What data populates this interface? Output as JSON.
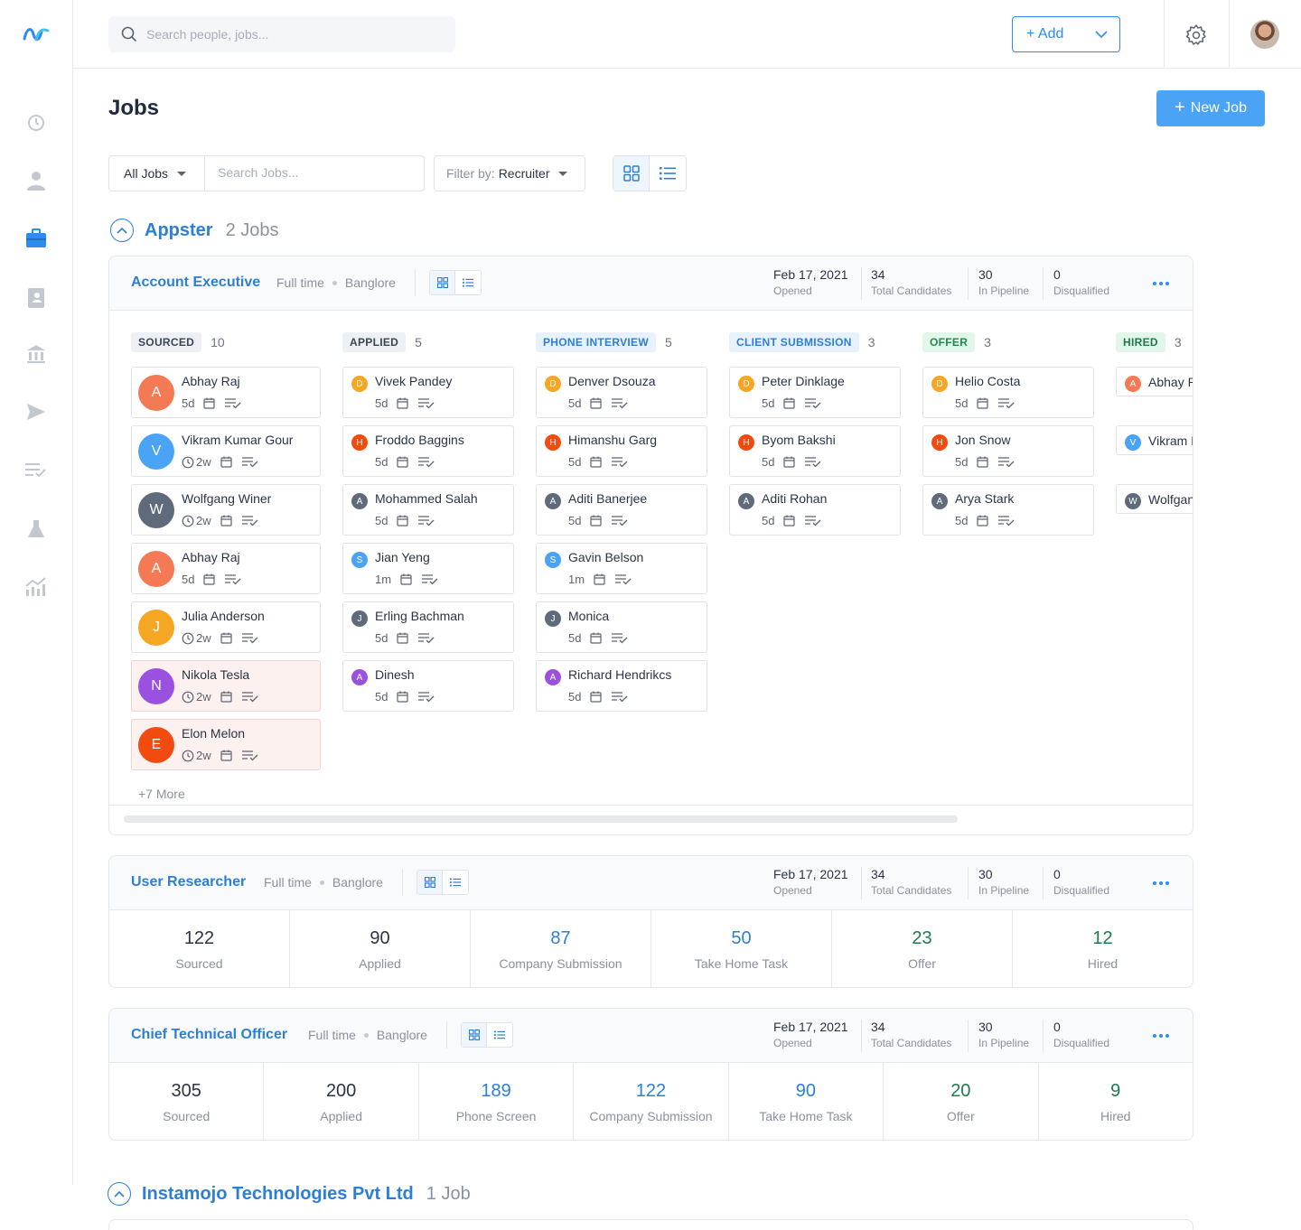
{
  "search": {
    "placeholder": "Search people, jobs..."
  },
  "header": {
    "add_label": "+ Add"
  },
  "page": {
    "title": "Jobs",
    "new_job_label": "New Job"
  },
  "filters": {
    "jobs_select": "All Jobs",
    "search_placeholder": "Search Jobs...",
    "filter_prefix": "Filter by:",
    "filter_value": "Recruiter"
  },
  "groups": [
    {
      "name": "Appster",
      "count": "2 Jobs"
    },
    {
      "name": "Instamojo Technologies Pvt Ltd",
      "count": "1 Job"
    }
  ],
  "stat_labels": {
    "opened": "Opened",
    "total": "Total Candidates",
    "pipeline": "In Pipeline",
    "disqualified": "Disqualified"
  },
  "jobs": [
    {
      "title": "Account Executive",
      "type": "Full time",
      "location": "Banglore",
      "opened": "Feb 17, 2021",
      "total": "34",
      "pipeline": "30",
      "disqualified": "0",
      "columns": [
        {
          "stage": "SOURCED",
          "count": "10",
          "more": "+7 More",
          "candidates": [
            {
              "name": "Abhay Raj",
              "initial": "A",
              "time": "5d",
              "clock": false,
              "color": "#f47a55",
              "flag": false
            },
            {
              "name": "Vikram Kumar Gour",
              "initial": "V",
              "time": "2w",
              "clock": true,
              "color": "#4aa3f5",
              "flag": false
            },
            {
              "name": "Wolfgang Winer",
              "initial": "W",
              "time": "2w",
              "clock": true,
              "color": "#5f6b7a",
              "flag": false
            },
            {
              "name": "Abhay Raj",
              "initial": "A",
              "time": "5d",
              "clock": false,
              "color": "#f47a55",
              "flag": false
            },
            {
              "name": "Julia Anderson",
              "initial": "J",
              "time": "2w",
              "clock": true,
              "color": "#f5a623",
              "flag": false
            },
            {
              "name": "Nikola Tesla",
              "initial": "N",
              "time": "2w",
              "clock": true,
              "color": "#9b51e0",
              "flag": true
            },
            {
              "name": "Elon Melon",
              "initial": "E",
              "time": "2w",
              "clock": true,
              "color": "#f24b0f",
              "flag": true
            }
          ]
        },
        {
          "stage": "APPLIED",
          "count": "5",
          "candidates": [
            {
              "name": "Vivek Pandey",
              "initial": "D",
              "time": "5d",
              "color": "#f5a623"
            },
            {
              "name": "Froddo Baggins",
              "initial": "H",
              "time": "5d",
              "color": "#f24b0f"
            },
            {
              "name": "Mohammed Salah",
              "initial": "A",
              "time": "5d",
              "color": "#5f6b7a"
            },
            {
              "name": "Jian Yeng",
              "initial": "S",
              "time": "1m",
              "color": "#4aa3f5"
            },
            {
              "name": "Erling Bachman",
              "initial": "J",
              "time": "5d",
              "color": "#5f6b7a"
            },
            {
              "name": "Dinesh",
              "initial": "A",
              "time": "5d",
              "color": "#9b51e0"
            }
          ]
        },
        {
          "stage": "PHONE INTERVIEW",
          "count": "5",
          "candidates": [
            {
              "name": "Denver Dsouza",
              "initial": "D",
              "time": "5d",
              "color": "#f5a623"
            },
            {
              "name": "Himanshu Garg",
              "initial": "H",
              "time": "5d",
              "color": "#f24b0f"
            },
            {
              "name": "Aditi Banerjee",
              "initial": "A",
              "time": "5d",
              "color": "#5f6b7a"
            },
            {
              "name": "Gavin Belson",
              "initial": "S",
              "time": "1m",
              "color": "#4aa3f5"
            },
            {
              "name": "Monica",
              "initial": "J",
              "time": "5d",
              "color": "#5f6b7a"
            },
            {
              "name": "Richard Hendrikcs",
              "initial": "A",
              "time": "5d",
              "color": "#9b51e0"
            }
          ]
        },
        {
          "stage": "CLIENT SUBMISSION",
          "count": "3",
          "candidates": [
            {
              "name": "Peter Dinklage",
              "initial": "D",
              "time": "5d",
              "color": "#f5a623"
            },
            {
              "name": "Byom Bakshi",
              "initial": "H",
              "time": "5d",
              "color": "#f24b0f"
            },
            {
              "name": "Aditi Rohan",
              "initial": "A",
              "time": "5d",
              "color": "#5f6b7a"
            }
          ]
        },
        {
          "stage": "OFFER",
          "count": "3",
          "candidates": [
            {
              "name": "Helio Costa",
              "initial": "D",
              "time": "5d",
              "color": "#f5a623"
            },
            {
              "name": "Jon Snow",
              "initial": "H",
              "time": "5d",
              "color": "#f24b0f"
            },
            {
              "name": "Arya Stark",
              "initial": "A",
              "time": "5d",
              "color": "#5f6b7a"
            }
          ]
        },
        {
          "stage": "HIRED",
          "count": "3",
          "candidates": [
            {
              "name": "Abhay Raj",
              "initial": "A",
              "color": "#f47a55"
            },
            {
              "name": "Vikram Kumar Gour",
              "initial": "V",
              "color": "#4aa3f5"
            },
            {
              "name": "Wolfgang Winer",
              "initial": "W",
              "color": "#5f6b7a"
            }
          ]
        }
      ]
    },
    {
      "title": "User Researcher",
      "type": "Full time",
      "location": "Banglore",
      "opened": "Feb 17, 2021",
      "total": "34",
      "pipeline": "30",
      "disqualified": "0",
      "summary": [
        {
          "value": "122",
          "label": "Sourced",
          "color": "#2b3445"
        },
        {
          "value": "90",
          "label": "Applied",
          "color": "#2b3445"
        },
        {
          "value": "87",
          "label": "Company Submission",
          "color": "#2d7fd6"
        },
        {
          "value": "50",
          "label": "Take Home Task",
          "color": "#2d7fd6"
        },
        {
          "value": "23",
          "label": "Offer",
          "color": "#1f7a4a"
        },
        {
          "value": "12",
          "label": "Hired",
          "color": "#1f7a4a"
        }
      ]
    },
    {
      "title": "Chief Technical Officer",
      "type": "Full time",
      "location": "Banglore",
      "opened": "Feb 17, 2021",
      "total": "34",
      "pipeline": "30",
      "disqualified": "0",
      "summary": [
        {
          "value": "305",
          "label": "Sourced",
          "color": "#2b3445"
        },
        {
          "value": "200",
          "label": "Applied",
          "color": "#2b3445"
        },
        {
          "value": "189",
          "label": "Phone Screen",
          "color": "#2d7fd6"
        },
        {
          "value": "122",
          "label": "Company Submission",
          "color": "#2d7fd6"
        },
        {
          "value": "90",
          "label": "Take Home Task",
          "color": "#2d7fd6"
        },
        {
          "value": "20",
          "label": "Offer",
          "color": "#1f7a4a"
        },
        {
          "value": "9",
          "label": "Hired",
          "color": "#1f7a4a"
        }
      ]
    }
  ],
  "stage_styles": {
    "SOURCED": {
      "bg": "#edf0f4",
      "fg": "#3a4556"
    },
    "APPLIED": {
      "bg": "#edf0f4",
      "fg": "#3a4556"
    },
    "PHONE INTERVIEW": {
      "bg": "#e8f2fd",
      "fg": "#2d7fd6"
    },
    "CLIENT SUBMISSION": {
      "bg": "#e8f2fd",
      "fg": "#2d7fd6"
    },
    "OFFER": {
      "bg": "#e3f6ea",
      "fg": "#1f8a4c"
    },
    "HIRED": {
      "bg": "#e3f6ea",
      "fg": "#1f7a4a"
    }
  },
  "colors": {
    "accent": "#2d8cf0",
    "primary_button": "#4aa3f5",
    "title_blue": "#2d7fd6"
  }
}
